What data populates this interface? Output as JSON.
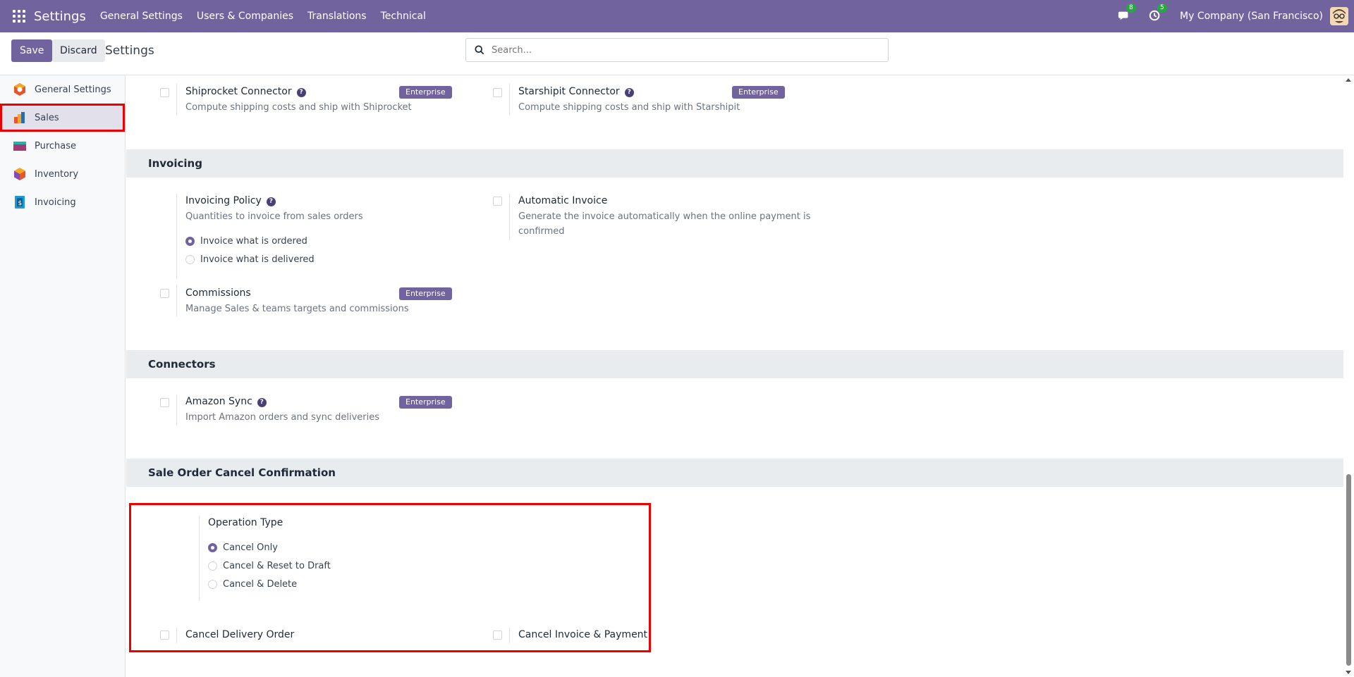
{
  "navbar": {
    "brand": "Settings",
    "menus": [
      "General Settings",
      "Users & Companies",
      "Translations",
      "Technical"
    ],
    "messages_count": "8",
    "activities_count": "5",
    "company": "My Company (San Francisco)",
    "bg_color": "#71639e"
  },
  "control_panel": {
    "save_label": "Save",
    "discard_label": "Discard",
    "title": "Settings",
    "search_placeholder": "Search..."
  },
  "sidebar": {
    "items": [
      {
        "label": "General Settings",
        "icon": "general-settings-icon"
      },
      {
        "label": "Sales",
        "icon": "sales-icon",
        "active": true
      },
      {
        "label": "Purchase",
        "icon": "purchase-icon"
      },
      {
        "label": "Inventory",
        "icon": "inventory-icon"
      },
      {
        "label": "Invoicing",
        "icon": "invoicing-icon"
      }
    ]
  },
  "shipping": {
    "shiprocket": {
      "title": "Shiprocket Connector",
      "desc": "Compute shipping costs and ship with Shiprocket",
      "badge": "Enterprise"
    },
    "starshipit": {
      "title": "Starshipit Connector",
      "desc": "Compute shipping costs and ship with Starshipit",
      "badge": "Enterprise"
    }
  },
  "invoicing": {
    "header": "Invoicing",
    "policy": {
      "title": "Invoicing Policy",
      "desc": "Quantities to invoice from sales orders",
      "options": [
        "Invoice what is ordered",
        "Invoice what is delivered"
      ],
      "selected": 0
    },
    "auto_invoice": {
      "title": "Automatic Invoice",
      "desc": "Generate the invoice automatically when the online payment is confirmed"
    },
    "commissions": {
      "title": "Commissions",
      "desc": "Manage Sales & teams targets and commissions",
      "badge": "Enterprise"
    }
  },
  "connectors": {
    "header": "Connectors",
    "amazon": {
      "title": "Amazon Sync",
      "desc": "Import Amazon orders and sync deliveries",
      "badge": "Enterprise"
    }
  },
  "cancel_confirmation": {
    "header": "Sale Order Cancel Confirmation",
    "operation_type": {
      "title": "Operation Type",
      "options": [
        "Cancel Only",
        "Cancel & Reset to Draft",
        "Cancel & Delete"
      ],
      "selected": 0
    },
    "cancel_delivery": "Cancel Delivery Order",
    "cancel_invoice": "Cancel Invoice & Payment"
  }
}
